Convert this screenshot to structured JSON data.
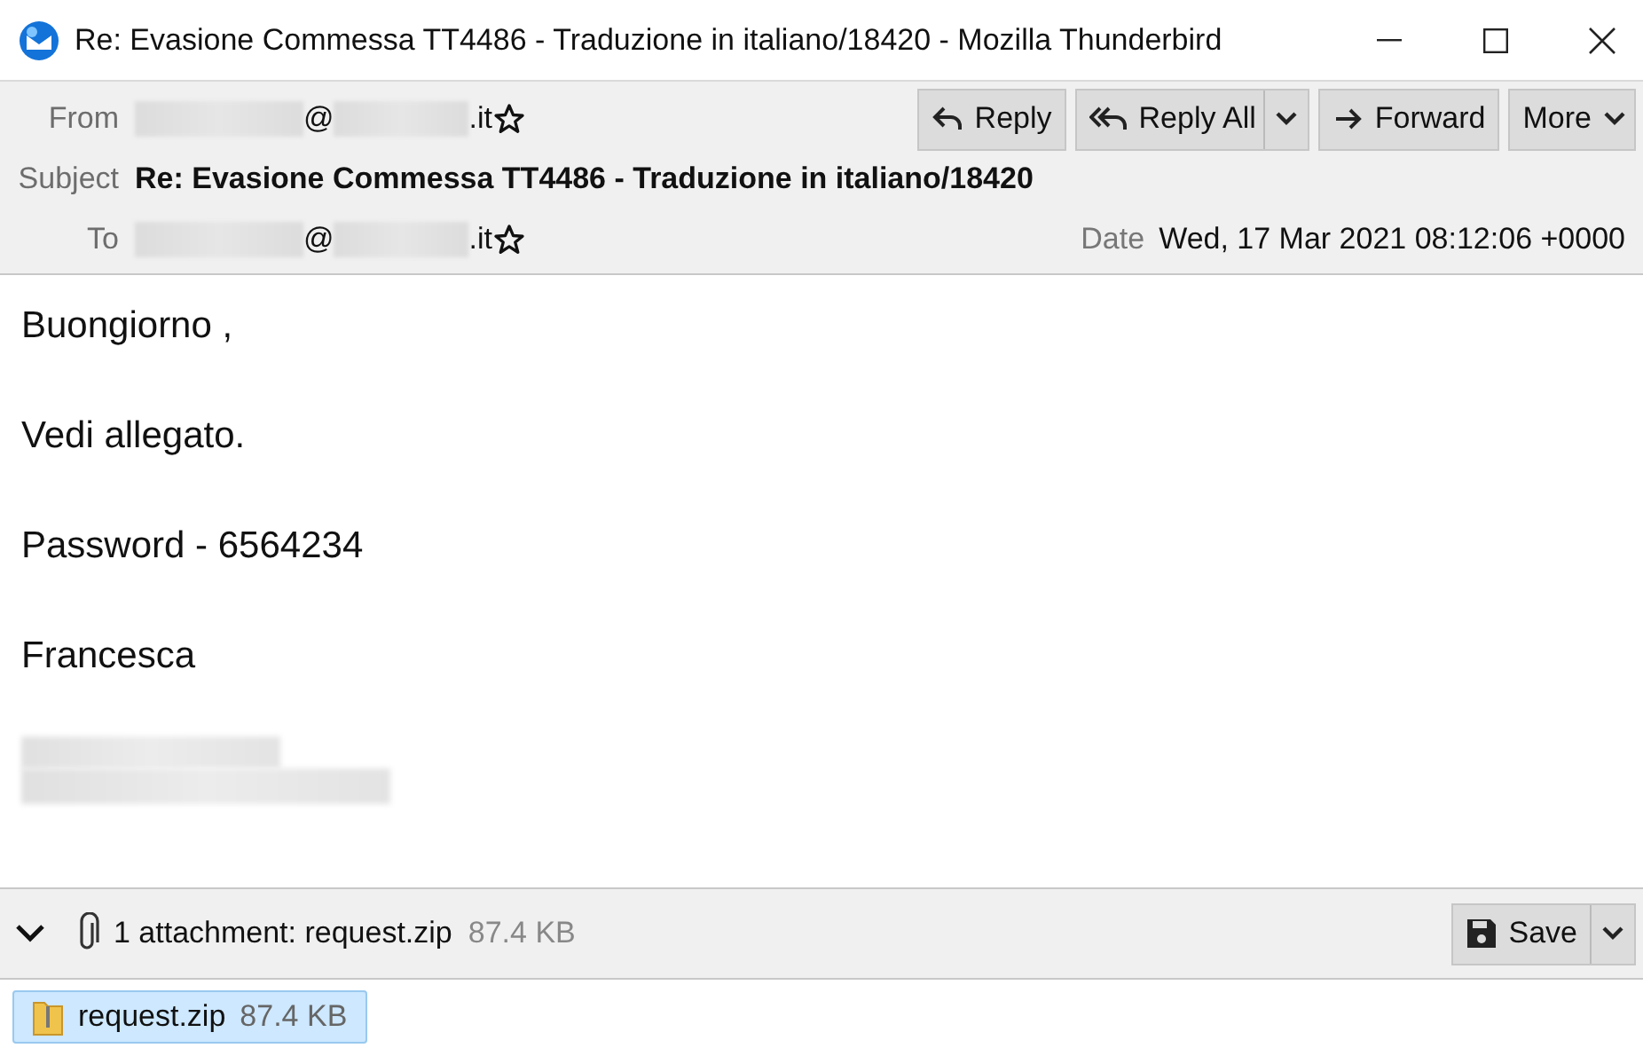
{
  "window": {
    "title": "Re: Evasione Commessa TT4486 - Traduzione in italiano/18420 - Mozilla Thunderbird"
  },
  "header": {
    "fields": [
      {
        "label": "From",
        "kind": "address",
        "parts": [
          "@",
          ".it"
        ]
      },
      {
        "label": "Subject",
        "kind": "subject",
        "value": "Re: Evasione Commessa TT4486 - Traduzione in italiano/18420"
      },
      {
        "label": "To",
        "kind": "address",
        "parts": [
          "@",
          ".it"
        ]
      }
    ],
    "date": {
      "label": "Date",
      "value": "Wed, 17 Mar 2021 08:12:06 +0000"
    },
    "buttons": [
      {
        "label": "Reply",
        "kind": "reply",
        "dropdown": false
      },
      {
        "label": "Reply All",
        "kind": "reply-all",
        "dropdown": true
      },
      {
        "label": "Forward",
        "kind": "forward",
        "dropdown": false
      },
      {
        "label": "More",
        "kind": "more",
        "dropdown": true
      }
    ]
  },
  "body": {
    "paragraphs": [
      "Buongiorno ,",
      "Vedi allegato.",
      "Password - 6564234",
      "Francesca"
    ]
  },
  "attachment_bar": {
    "expanded": true,
    "summary": "1 attachment: request.zip",
    "size": "87.4 KB",
    "save_label": "Save"
  },
  "attachments": [
    {
      "name": "request.zip",
      "size": "87.4 KB",
      "selected": true
    }
  ]
}
